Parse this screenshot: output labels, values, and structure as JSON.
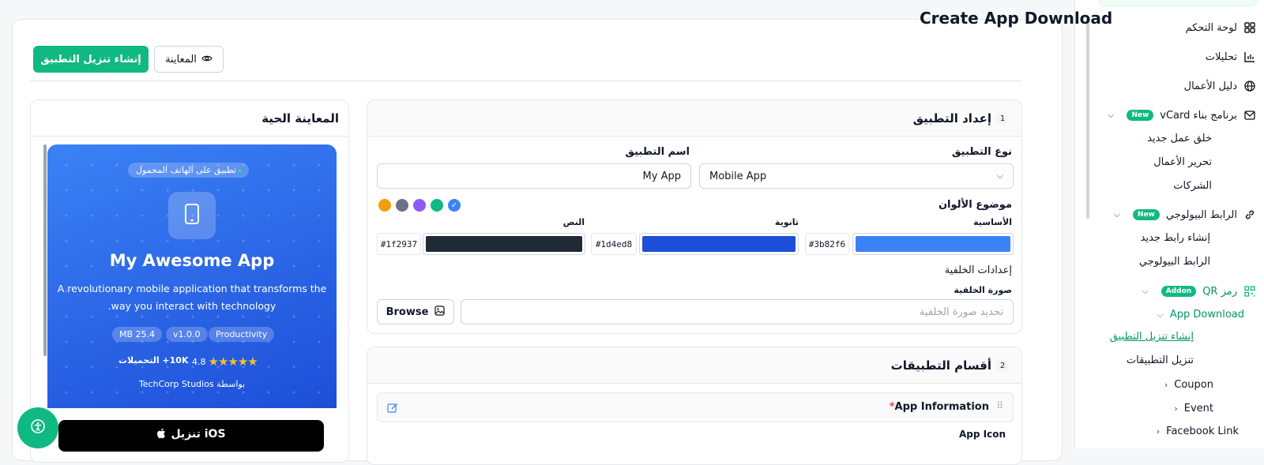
{
  "page": {
    "title": "Create App Download"
  },
  "toolbar": {
    "create_label": "إنشاء تنزيل التطبيق",
    "preview_label": "المعاينة"
  },
  "sidebar": {
    "items": [
      {
        "label": "لوحة التحكم",
        "icon": "dashboard-icon"
      },
      {
        "label": "تحليلات",
        "icon": "chart-icon"
      },
      {
        "label": "دليل الأعمال",
        "icon": "globe-icon"
      },
      {
        "label": "برنامج بناء vCard",
        "icon": "mail-icon",
        "badge": "New"
      },
      {
        "label": "الرابط البيولوجي",
        "icon": "link-icon",
        "badge": "New"
      },
      {
        "label": "رمز QR",
        "icon": "qr-icon",
        "badge": "Addon"
      }
    ],
    "vcard_sub": [
      "خلق عمل جديد",
      "تحرير الأعمال",
      "الشركات"
    ],
    "bio_sub": [
      "إنشاء رابط جديد",
      "الرابط البيولوجي"
    ],
    "qr_group": "App Download",
    "qr_sub": [
      "إنشاء تنزيل التطبيق",
      "تنزيل التطبيقات"
    ],
    "collapsed": [
      "Coupon",
      "Event",
      "Facebook Link"
    ]
  },
  "setup": {
    "number": "1",
    "title": "إعداد التطبيق",
    "app_type_label": "نوع التطبيق",
    "app_type_value": "Mobile App",
    "app_name_label": "اسم التطبيق",
    "app_name_value": "My App",
    "theme_label": "موضوع الألوان",
    "theme_swatches": [
      "#3b82f6",
      "#10b981",
      "#8b5cf6",
      "#6b7280",
      "#f59e0b"
    ],
    "primary_label": "الأساسية",
    "primary_hex": "#3b82f6",
    "secondary_label": "ثانوية",
    "secondary_hex": "#1d4ed8",
    "text_label": "النص",
    "text_hex": "#1f2937",
    "bg_settings_label": "إعدادات الخلفية",
    "bg_image_label": "صورة الخلفية",
    "bg_placeholder": "تحديد صورة الخلفية",
    "browse_label": "Browse"
  },
  "sections": {
    "number": "2",
    "title": "أقسام التطبيقات",
    "item_title": "App Information",
    "required_mark": "*",
    "next_label": "App Icon"
  },
  "preview": {
    "title": "المعاينة الحية",
    "badge": "تطبيق على الهاتف المحمول",
    "app_name": "My Awesome App",
    "description_1": "A revolutionary mobile application that transforms the",
    "description_2": "way you interact with technology.",
    "tags": [
      "Productivity",
      "v1.0.0",
      "25.4 MB"
    ],
    "rating": "4.8",
    "stars": 5,
    "downloads": "10K+ التحميلات",
    "developer": "بواسطة TechCorp Studios",
    "ios_label": "تنزيل iOS"
  }
}
